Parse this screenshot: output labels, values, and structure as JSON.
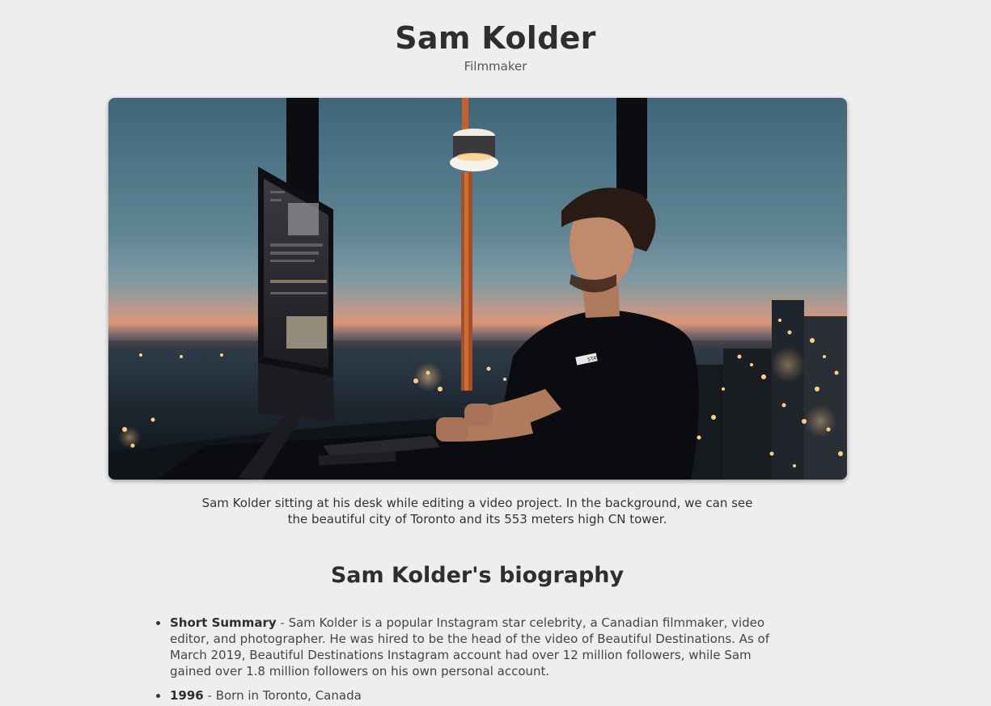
{
  "header": {
    "name": "Sam Kolder",
    "role": "Filmmaker"
  },
  "hero": {
    "caption": "Sam Kolder sitting at his desk while editing a video project. In the background, we can see the beautiful city of Toronto and its 553 meters high CN tower.",
    "monitor_badge": "STAY"
  },
  "biography": {
    "heading": "Sam Kolder's biography",
    "items": [
      {
        "term": "Short Summary",
        "separator": " - ",
        "text": "Sam Kolder is a popular Instagram star celebrity, a Canadian filmmaker, video editor, and photographer. He was hired to be the head of the video of Beautiful Destinations. As of March 2019, Beautiful Destinations Instagram account had over 12 million followers, while Sam gained over 1.8 million followers on his own personal account."
      },
      {
        "term": "1996",
        "separator": " - ",
        "text": "Born in Toronto, Canada"
      }
    ]
  },
  "colors": {
    "background": "#eeeeee",
    "text": "#333333",
    "sky_top": "#466c7e",
    "sky_horizon": "#d9967a"
  }
}
